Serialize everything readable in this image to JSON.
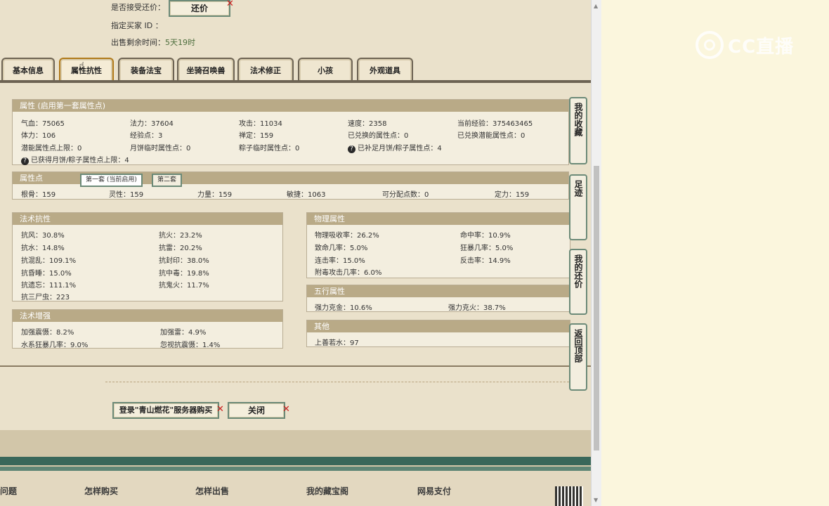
{
  "top_info": {
    "accept_offer_label": "是否接受还价：",
    "offer_button": "还价",
    "buyer_id_label": "指定买家 ID ：",
    "time_left_label": "出售剩余时间：",
    "time_left_value": "5天19时"
  },
  "tabs": [
    "基本信息",
    "属性抗性",
    "装备法宝",
    "坐骑召唤兽",
    "法术修正",
    "小孩",
    "外观道具"
  ],
  "active_tab": 1,
  "attributes": {
    "header": "属性 (启用第一套属性点)",
    "rows": [
      [
        "气血：75065",
        "法力：37604",
        "攻击：11034",
        "速度：2358",
        "当前经验：375463465"
      ],
      [
        "体力：106",
        "经验点：3",
        "禅定：159",
        "已兑换的属性点：0",
        "已兑换潜能属性点：0"
      ],
      [
        "潜能属性点上限：0",
        "月饼临时属性点：0",
        "粽子临时属性点：0",
        "已补足月饼/粽子属性点：4",
        ""
      ]
    ],
    "note": "已获得月饼/粽子属性点上限：4"
  },
  "points": {
    "header": "属性点",
    "subtabs": [
      "第一套 (当前启用)",
      "第二套"
    ],
    "values": [
      "根骨：159",
      "灵性：159",
      "力量：159",
      "敏捷：1063",
      "可分配点数：0",
      "定力：159"
    ]
  },
  "magic_resist": {
    "header": "法术抗性",
    "items": [
      "抗风：30.8%",
      "抗火：23.2%",
      "抗水：14.8%",
      "抗雷：20.2%",
      "抗混乱：109.1%",
      "抗封印：38.0%",
      "抗昏睡：15.0%",
      "抗中毒：19.8%",
      "抗遗忘：111.1%",
      "抗鬼火：11.7%",
      "抗三尸虫：223",
      ""
    ]
  },
  "magic_boost": {
    "header": "法术增强",
    "items": [
      "加强震慑：8.2%",
      "加强雷：4.9%",
      "水系狂暴几率：9.0%",
      "忽视抗震慑：1.4%"
    ]
  },
  "physical": {
    "header": "物理属性",
    "items": [
      "物理吸收率：26.2%",
      "命中率：10.9%",
      "致命几率：5.0%",
      "狂暴几率：5.0%",
      "连击率：15.0%",
      "反击率：14.9%",
      "附毒攻击几率：6.0%",
      ""
    ]
  },
  "five_elements": {
    "header": "五行属性",
    "items": [
      "强力克金：10.6%",
      "强力克火：38.7%"
    ]
  },
  "other": {
    "header": "其他",
    "items": [
      "上善若水：97"
    ]
  },
  "side_buttons": [
    "我的收藏",
    "足迹",
    "我的还价",
    "返回顶部"
  ],
  "bottom_buttons": {
    "login_buy": "登录\"青山燃花\"服务器购买",
    "close": "关闭"
  },
  "footer_links": [
    "问题",
    "怎样购买",
    "怎样出售",
    "我的藏宝阁",
    "网易支付"
  ],
  "watermark": "CC直播",
  "colors": {
    "panel_header": "#b9aa87",
    "tab_border": "#6d6353",
    "active_tab_border": "#b07a1a",
    "accent_green": "#39675a",
    "close_x": "#cc1f1f"
  }
}
